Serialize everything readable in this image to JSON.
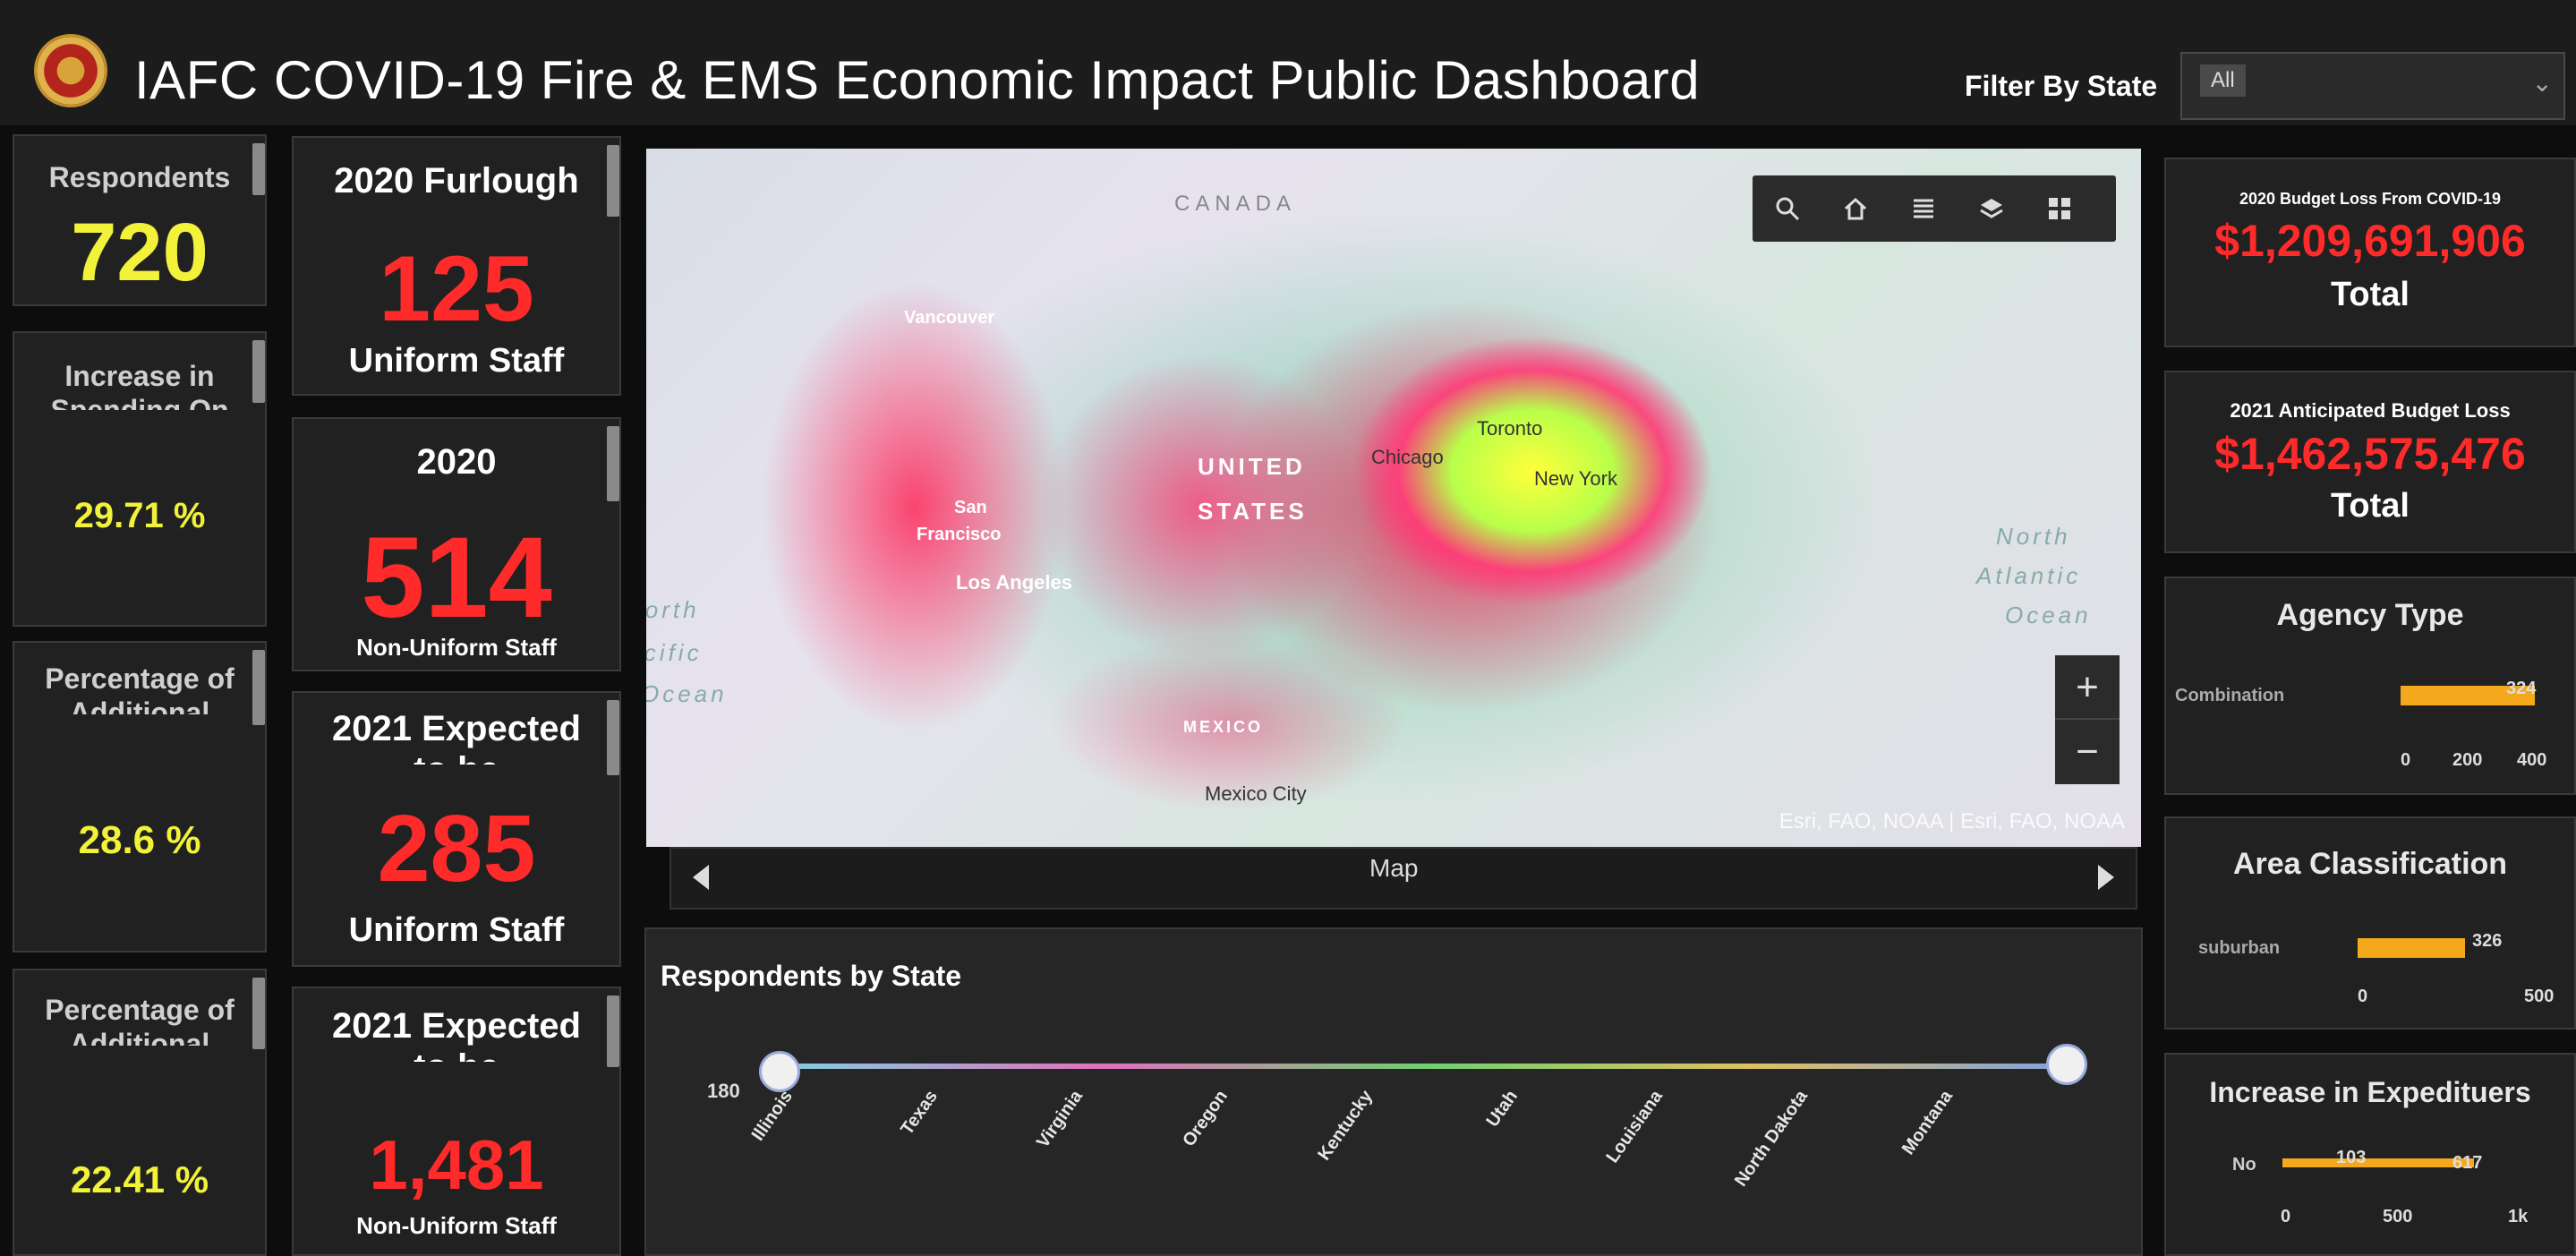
{
  "header": {
    "title": "IAFC COVID-19 Fire & EMS Economic Impact Public Dashboard",
    "filter_label": "Filter By State",
    "filter_value": "All"
  },
  "col1": {
    "respondents_label": "Respondents",
    "respondents_value": "720",
    "card2_label_1": "Increase in",
    "card2_label_2": "Spending On",
    "card2_value": "29.71 %",
    "card3_label_1": "Percentage of",
    "card3_label_2": "Additional",
    "card3_value": "28.6 %",
    "card4_label_1": "Percentage of",
    "card4_label_2": "Additional",
    "card4_value": "22.41 %"
  },
  "col2": {
    "c1_title": "2020 Furlough",
    "c1_value": "125",
    "c1_sub": "Uniform Staff",
    "c2_title": "2020",
    "c2_value": "514",
    "c2_sub": "Non-Uniform Staff",
    "c3_title_1": "2021 Expected",
    "c3_title_2": "to be",
    "c3_value": "285",
    "c3_sub": "Uniform Staff",
    "c4_title_1": "2021 Expected",
    "c4_title_2": "to be",
    "c4_value": "1,481",
    "c4_sub": "Non-Uniform Staff"
  },
  "map": {
    "labels": {
      "canada": "CANADA",
      "vancouver": "Vancouver",
      "united": "UNITED",
      "states": "STATES",
      "chicago": "Chicago",
      "toronto": "Toronto",
      "new_york": "New York",
      "san": "San",
      "francisco": "Francisco",
      "los_angeles": "Los Angeles",
      "north_atlantic_1": "North",
      "north_atlantic_2": "Atlantic",
      "north_atlantic_3": "Ocean",
      "north_pacific_1": "North",
      "north_pacific_2": "Pacific",
      "north_pacific_3": "Ocean",
      "mexico": "MEXICO",
      "mexico_city": "Mexico City"
    },
    "attribution": "Esri, FAO, NOAA | Esri, FAO, NOAA",
    "zoom_in": "+",
    "zoom_out": "−",
    "tab_label": "Map",
    "toolbar_icons": [
      "search-icon",
      "home-icon",
      "list-icon",
      "layers-icon",
      "basemap-gallery-icon"
    ]
  },
  "state_chart": {
    "title": "Respondents by State",
    "slider_min_label": "180",
    "states": [
      "Illinois",
      "Texas",
      "Virginia",
      "Oregon",
      "Kentucky",
      "Utah",
      "Louisiana",
      "North Dakota",
      "Montana"
    ]
  },
  "right": {
    "budget2020_title": "2020 Budget Loss From COVID-19",
    "budget2020_value": "$1,209,691,906",
    "budget2020_sub": "Total",
    "budget2021_title": "2021 Anticipated Budget Loss",
    "budget2021_value": "$1,462,575,476",
    "budget2021_sub": "Total",
    "agency_title": "Agency Type",
    "agency_label": "Combination",
    "agency_value": "324",
    "agency_axis": [
      "0",
      "200",
      "400"
    ],
    "area_title": "Area Classification",
    "area_label": "suburban",
    "area_value": "326",
    "area_axis": [
      "0",
      "500"
    ],
    "exp_title": "Increase in Expedituers",
    "exp_label_no": "No",
    "exp_no_value": "103",
    "exp_yes_value": "617",
    "exp_axis": [
      "0",
      "500",
      "1k"
    ]
  },
  "colors": {
    "yellow": "#f2f23a",
    "red": "#ff2a2a",
    "orange_bar": "#f4a81c",
    "panel": "#212121"
  }
}
